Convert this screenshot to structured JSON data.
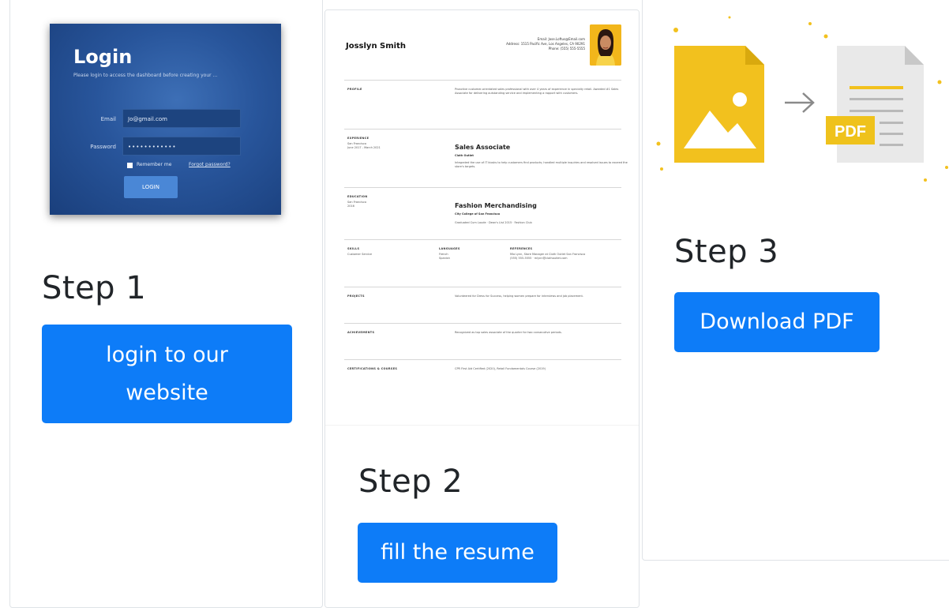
{
  "steps": [
    {
      "title": "Step 1",
      "button": "login to our website",
      "thumbnail": {
        "title": "Login",
        "subtitle": "Please login to access the dashboard before creating your ...",
        "email_label": "Email",
        "email_value": "Jo@gmail.com",
        "password_label": "Password",
        "password_value": "••••••••••••",
        "remember_label": "Remember me",
        "forgot_label": "Forgot password?",
        "login_button": "LOGIN"
      }
    },
    {
      "title": "Step 2",
      "button": "fill the resume",
      "resume": {
        "name": "Josslyn Smith",
        "contact": [
          "Email: Jose.Loftus@Email.com",
          "Address: 1515 Pacific Ave, Los Angeles, CA 90291",
          "Phone: (555) 555-5555"
        ],
        "sections": [
          {
            "heading": "PROFILE",
            "text": "Proactive customer-orientated sales professional with over 4 years of experience in specialty retail. Awarded #1 Sales Associate for delivering outstanding service and implementing a rapport with customers."
          },
          {
            "heading": "EXPERIENCE",
            "left": "San Francisco\nJune 2017 - March 2021",
            "title": "Sales Associate",
            "sub": "Cloth Outlet",
            "text": "Integrated the use of IT kiosks to help customers find products; handled multiple inquiries and resolved issues to exceed the store's targets."
          },
          {
            "heading": "EDUCATION",
            "left": "San Francisco\n2016",
            "title": "Fashion Merchandising",
            "sub": "City College of San Francisco",
            "text": "Graduated Cum Laude · Dean's List 2015 · Fashion Club"
          },
          {
            "heading": "SKILLS",
            "skills": "Customer Service",
            "languages_heading": "LANGUAGES",
            "languages": "French\nSpanish",
            "references_heading": "REFERENCES",
            "references": "Mia Lynn, Store Manager at Cloth Outlet San Francisco\n(555) 555-5555 · mlynn@clothoutlet.com"
          },
          {
            "heading": "PROJECTS",
            "text": "Volunteered for Dress for Success, helping women prepare for interviews and job placement."
          },
          {
            "heading": "ACHIEVEMENTS",
            "text": "Recognized as top sales associate of the quarter for two consecutive periods."
          },
          {
            "heading": "CERTIFICATIONS & COURSES",
            "text": "CPR First Aid Certified (2020), Retail Fundamentals Course (2019)"
          }
        ]
      }
    },
    {
      "title": "Step 3",
      "button": "Download PDF",
      "illustration": {
        "pdf_label": "PDF",
        "arrow": "→"
      }
    }
  ],
  "colors": {
    "button_bg": "#0d7cf8",
    "button_text": "#ffffff",
    "image_yellow": "#f2c11e",
    "pdf_badge": "#efc21c",
    "doc_gray": "#e9e9e9",
    "login_bg": "#28559b"
  }
}
